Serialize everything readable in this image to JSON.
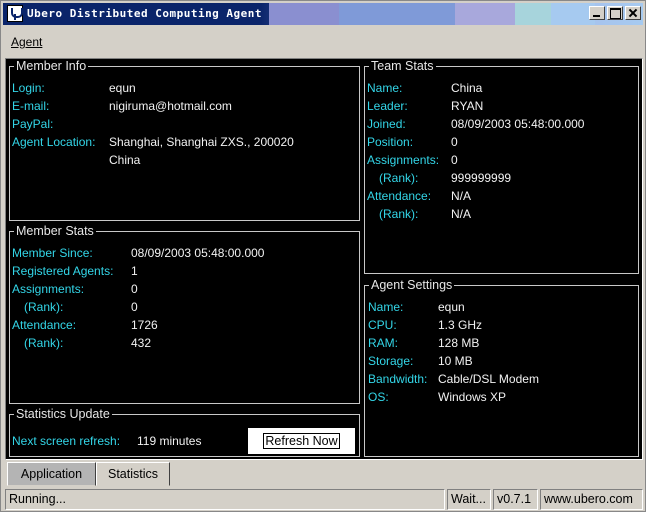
{
  "window": {
    "title": "Ubero Distributed Computing Agent"
  },
  "menu": {
    "agent_label": "Agent"
  },
  "member_info": {
    "title": "Member Info",
    "login_label": "Login:",
    "login_value": "equn",
    "email_label": "E-mail:",
    "email_value": "nigiruma@hotmail.com",
    "paypal_label": "PayPal:",
    "paypal_value": "",
    "location_label": "Agent Location:",
    "location_line1": "Shanghai, Shanghai ZXS., 200020",
    "location_line2": "China"
  },
  "team_stats": {
    "title": "Team Stats",
    "name_label": "Name:",
    "name_value": "China",
    "leader_label": "Leader:",
    "leader_value": "RYAN",
    "joined_label": "Joined:",
    "joined_value": "08/09/2003 05:48:00.000",
    "position_label": "Position:",
    "position_value": "0",
    "assignments_label": "Assignments:",
    "assignments_value": "0",
    "assign_rank_label": "(Rank):",
    "assign_rank_value": "999999999",
    "attendance_label": "Attendance:",
    "attendance_value": "N/A",
    "attend_rank_label": "(Rank):",
    "attend_rank_value": "N/A"
  },
  "member_stats": {
    "title": "Member Stats",
    "since_label": "Member Since:",
    "since_value": "08/09/2003 05:48:00.000",
    "agents_label": "Registered Agents:",
    "agents_value": "1",
    "assignments_label": "Assignments:",
    "assignments_value": "0",
    "assign_rank_label": "(Rank):",
    "assign_rank_value": "0",
    "attendance_label": "Attendance:",
    "attendance_value": "1726",
    "attend_rank_label": "(Rank):",
    "attend_rank_value": "432"
  },
  "agent_settings": {
    "title": "Agent Settings",
    "name_label": "Name:",
    "name_value": "equn",
    "cpu_label": "CPU:",
    "cpu_value": "1.3 GHz",
    "ram_label": "RAM:",
    "ram_value": "128 MB",
    "storage_label": "Storage:",
    "storage_value": "10 MB",
    "bandwidth_label": "Bandwidth:",
    "bandwidth_value": "Cable/DSL Modem",
    "os_label": "OS:",
    "os_value": "Windows XP"
  },
  "statistics_update": {
    "title": "Statistics Update",
    "refresh_label": "Next screen refresh:",
    "refresh_value": "119 minutes",
    "refresh_button": "Refresh Now"
  },
  "tabs": {
    "application": "Application",
    "statistics": "Statistics",
    "active": "Application"
  },
  "status": {
    "message": "Running...",
    "state": "Wait...",
    "version": "v0.7.1",
    "site": "www.ubero.com"
  },
  "colors": {
    "label": "#33d6e8",
    "value": "#f2f2f2",
    "panel": "#000000",
    "title_bar": "#0a246a"
  }
}
